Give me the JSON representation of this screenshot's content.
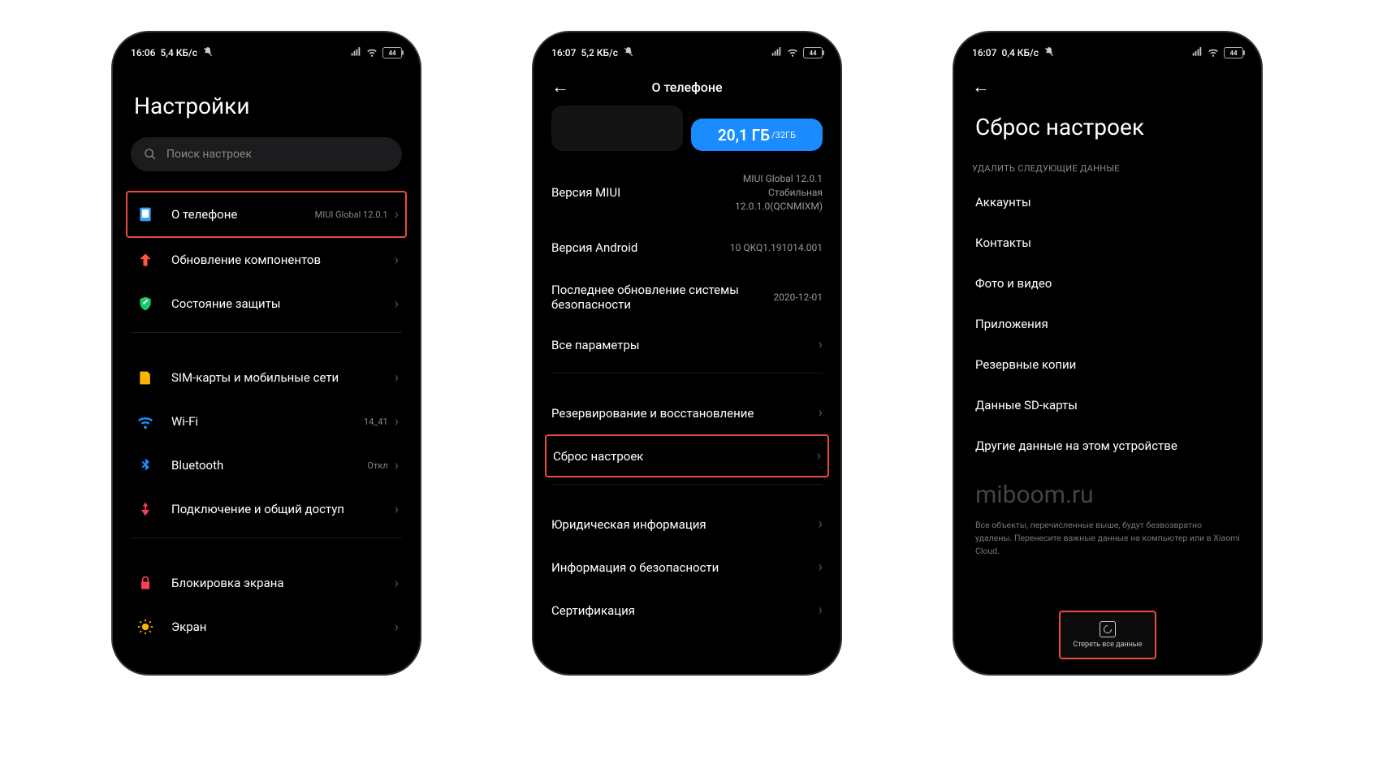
{
  "phone1": {
    "status": {
      "time": "16:06",
      "net": "5,4 КБ/с",
      "battery": "44"
    },
    "title": "Настройки",
    "search_placeholder": "Поиск настроек",
    "rows": {
      "about": {
        "label": "О телефоне",
        "sub": "MIUI Global 12.0.1"
      },
      "update": {
        "label": "Обновление компонентов"
      },
      "security": {
        "label": "Состояние защиты"
      },
      "sim": {
        "label": "SIM-карты и мобильные сети"
      },
      "wifi": {
        "label": "Wi-Fi",
        "sub": "14_41"
      },
      "bluetooth": {
        "label": "Bluetooth",
        "sub": "Откл"
      },
      "share": {
        "label": "Подключение и общий доступ"
      },
      "lock": {
        "label": "Блокировка экрана"
      },
      "display": {
        "label": "Экран"
      }
    }
  },
  "phone2": {
    "status": {
      "time": "16:07",
      "net": "5,2 КБ/с",
      "battery": "44"
    },
    "title": "О телефоне",
    "storage": {
      "used": "20,1 ГБ",
      "total": "/32ГБ"
    },
    "rows": {
      "miui": {
        "label": "Версия MIUI",
        "val": "MIUI Global 12.0.1\nСтабильная\n12.0.1.0(QCNMIXM)"
      },
      "android": {
        "label": "Версия Android",
        "val": "10 QKQ1.191014.001"
      },
      "patch": {
        "label": "Последнее обновление системы безопасности",
        "val": "2020-12-01"
      },
      "allspec": {
        "label": "Все параметры"
      },
      "backup": {
        "label": "Резервирование и восстановление"
      },
      "reset": {
        "label": "Сброс настроек"
      },
      "legal": {
        "label": "Юридическая информация"
      },
      "safety": {
        "label": "Информация о безопасности"
      },
      "cert": {
        "label": "Сертификация"
      }
    }
  },
  "phone3": {
    "status": {
      "time": "16:07",
      "net": "0,4 КБ/с",
      "battery": "44"
    },
    "title": "Сброс настроек",
    "section": "УДАЛИТЬ СЛЕДУЮЩИЕ ДАННЫЕ",
    "items": {
      "accounts": "Аккаунты",
      "contacts": "Контакты",
      "photos": "Фото и видео",
      "apps": "Приложения",
      "backups": "Резервные копии",
      "sd": "Данные SD-карты",
      "other": "Другие данные на этом устройстве"
    },
    "watermark": "miboom.ru",
    "footnote": "Все объекты, перечисленные выше, будут безвозвратно удалены. Перенесите важные данные на компьютер или в Xiaomi Cloud.",
    "erase_btn": "Стереть все данные"
  }
}
